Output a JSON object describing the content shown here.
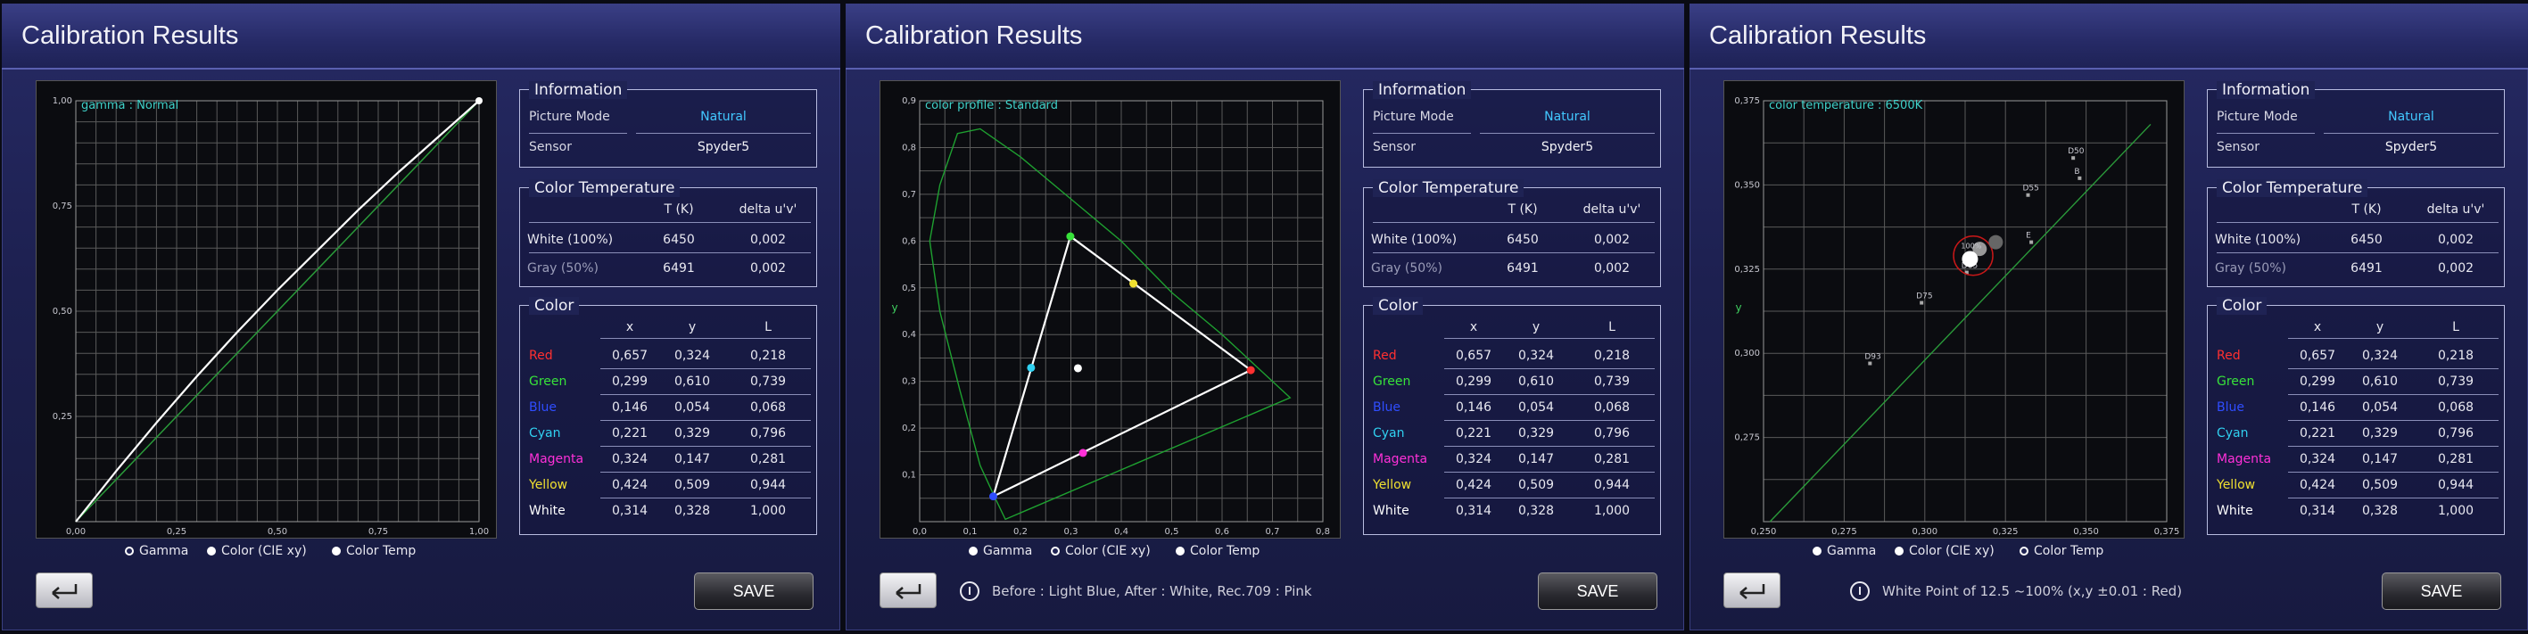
{
  "colors": {
    "red": "#ff3030",
    "green": "#37e23a",
    "blue": "#2f4dff",
    "cyan": "#30d0f0",
    "magenta": "#ff30d8",
    "yellow": "#f0e030",
    "white": "#ffffff",
    "accent": "#42c8ff"
  },
  "common": {
    "title": "Calibration Results",
    "save_label": "SAVE",
    "back_icon": "return-arrow-icon",
    "info_icon": "info-circle-icon",
    "radios": [
      "Gamma",
      "Color (CIE xy)",
      "Color Temp"
    ],
    "information": {
      "title": "Information",
      "rows": [
        {
          "label": "Picture Mode",
          "value": "Natural"
        },
        {
          "label": "Sensor",
          "value": "Spyder5"
        }
      ]
    },
    "color_temperature": {
      "title": "Color Temperature",
      "headers": [
        "T (K)",
        "delta u'v'"
      ],
      "rows": [
        {
          "label": "White (100%)",
          "t": "6450",
          "delta": "0,002"
        },
        {
          "label": "Gray (50%)",
          "t": "6491",
          "delta": "0,002"
        }
      ]
    },
    "color": {
      "title": "Color",
      "headers": [
        "x",
        "y",
        "L"
      ],
      "rows": [
        {
          "label": "Red",
          "x": "0,657",
          "y": "0,324",
          "l": "0,218"
        },
        {
          "label": "Green",
          "x": "0,299",
          "y": "0,610",
          "l": "0,739"
        },
        {
          "label": "Blue",
          "x": "0,146",
          "y": "0,054",
          "l": "0,068"
        },
        {
          "label": "Cyan",
          "x": "0,221",
          "y": "0,329",
          "l": "0,796"
        },
        {
          "label": "Magenta",
          "x": "0,324",
          "y": "0,147",
          "l": "0,281"
        },
        {
          "label": "Yellow",
          "x": "0,424",
          "y": "0,509",
          "l": "0,944"
        },
        {
          "label": "White",
          "x": "0,314",
          "y": "0,328",
          "l": "1,000"
        }
      ]
    }
  },
  "screens": [
    {
      "selected_radio": 0,
      "chart_label": "gamma : Normal",
      "note": "",
      "xticks": [
        "0,00",
        "0,25",
        "0,50",
        "0,75",
        "1,00"
      ],
      "yticks": [
        "0,25",
        "0,50",
        "0,75",
        "1,00"
      ]
    },
    {
      "selected_radio": 1,
      "chart_label": "color profile : Standard",
      "note": "Before : Light Blue,   After : White,   Rec.709 : Pink",
      "xticks": [
        "0,0",
        "0,1",
        "0,2",
        "0,3",
        "0,4",
        "0,5",
        "0,6",
        "0,7",
        "0,8"
      ],
      "yticks": [
        "0,1",
        "0,2",
        "0,3",
        "0,4",
        "0,5",
        "0,6",
        "0,7",
        "0,8",
        "0,9"
      ],
      "xlabel": "x",
      "ylabel": "y"
    },
    {
      "selected_radio": 2,
      "chart_label": "color temperature : 6500K",
      "note": "White Point of 12.5 ~100% (x,y ±0.01 : Red)",
      "xticks": [
        "0,250",
        "0,275",
        "0,300",
        "0,325",
        "0,350",
        "0,375"
      ],
      "yticks": [
        "0,275",
        "0,300",
        "0,325",
        "0,350",
        "0,375"
      ],
      "xlabel": "x",
      "ylabel": "y",
      "locus_labels": [
        "D50",
        "D55",
        "D65",
        "D75",
        "D93",
        "E",
        "B"
      ],
      "point_labels": [
        "100%"
      ]
    }
  ],
  "chart_data": [
    {
      "type": "line",
      "title": "gamma : Normal",
      "xlim": [
        0,
        1
      ],
      "ylim": [
        0,
        1
      ],
      "series": [
        {
          "x": [
            0,
            0.1,
            0.2,
            0.3,
            0.4,
            0.5,
            0.6,
            0.7,
            0.8,
            0.9,
            1.0
          ],
          "values": [
            0,
            0.12,
            0.235,
            0.345,
            0.45,
            0.55,
            0.645,
            0.74,
            0.83,
            0.915,
            1.0
          ]
        },
        {
          "x": [
            0,
            1
          ],
          "values": [
            0,
            1
          ]
        }
      ]
    },
    {
      "type": "scatter",
      "title": "color profile : Standard",
      "xlim": [
        0,
        0.8
      ],
      "ylim": [
        0,
        0.9
      ],
      "series": [
        {
          "x": [
            0.657,
            0.299,
            0.146
          ],
          "values": [
            0.324,
            0.61,
            0.054
          ]
        },
        {
          "x": [
            0.221,
            0.324,
            0.424,
            0.314
          ],
          "values": [
            0.329,
            0.147,
            0.509,
            0.328
          ]
        },
        {
          "x": [
            0.74,
            0.17,
            0.16
          ],
          "values": [
            0.26,
            0.7,
            0.01
          ]
        }
      ]
    },
    {
      "type": "scatter",
      "title": "color temperature : 6500K",
      "xlim": [
        0.25,
        0.375
      ],
      "ylim": [
        0.25,
        0.375
      ],
      "series": [
        {
          "x": [
            0.314,
            0.317,
            0.322
          ],
          "values": [
            0.328,
            0.331,
            0.333
          ]
        },
        {
          "x": [
            0.346,
            0.332,
            0.313,
            0.299,
            0.283,
            0.333,
            0.348
          ],
          "values": [
            0.358,
            0.347,
            0.324,
            0.315,
            0.297,
            0.333,
            0.352
          ]
        }
      ]
    }
  ]
}
